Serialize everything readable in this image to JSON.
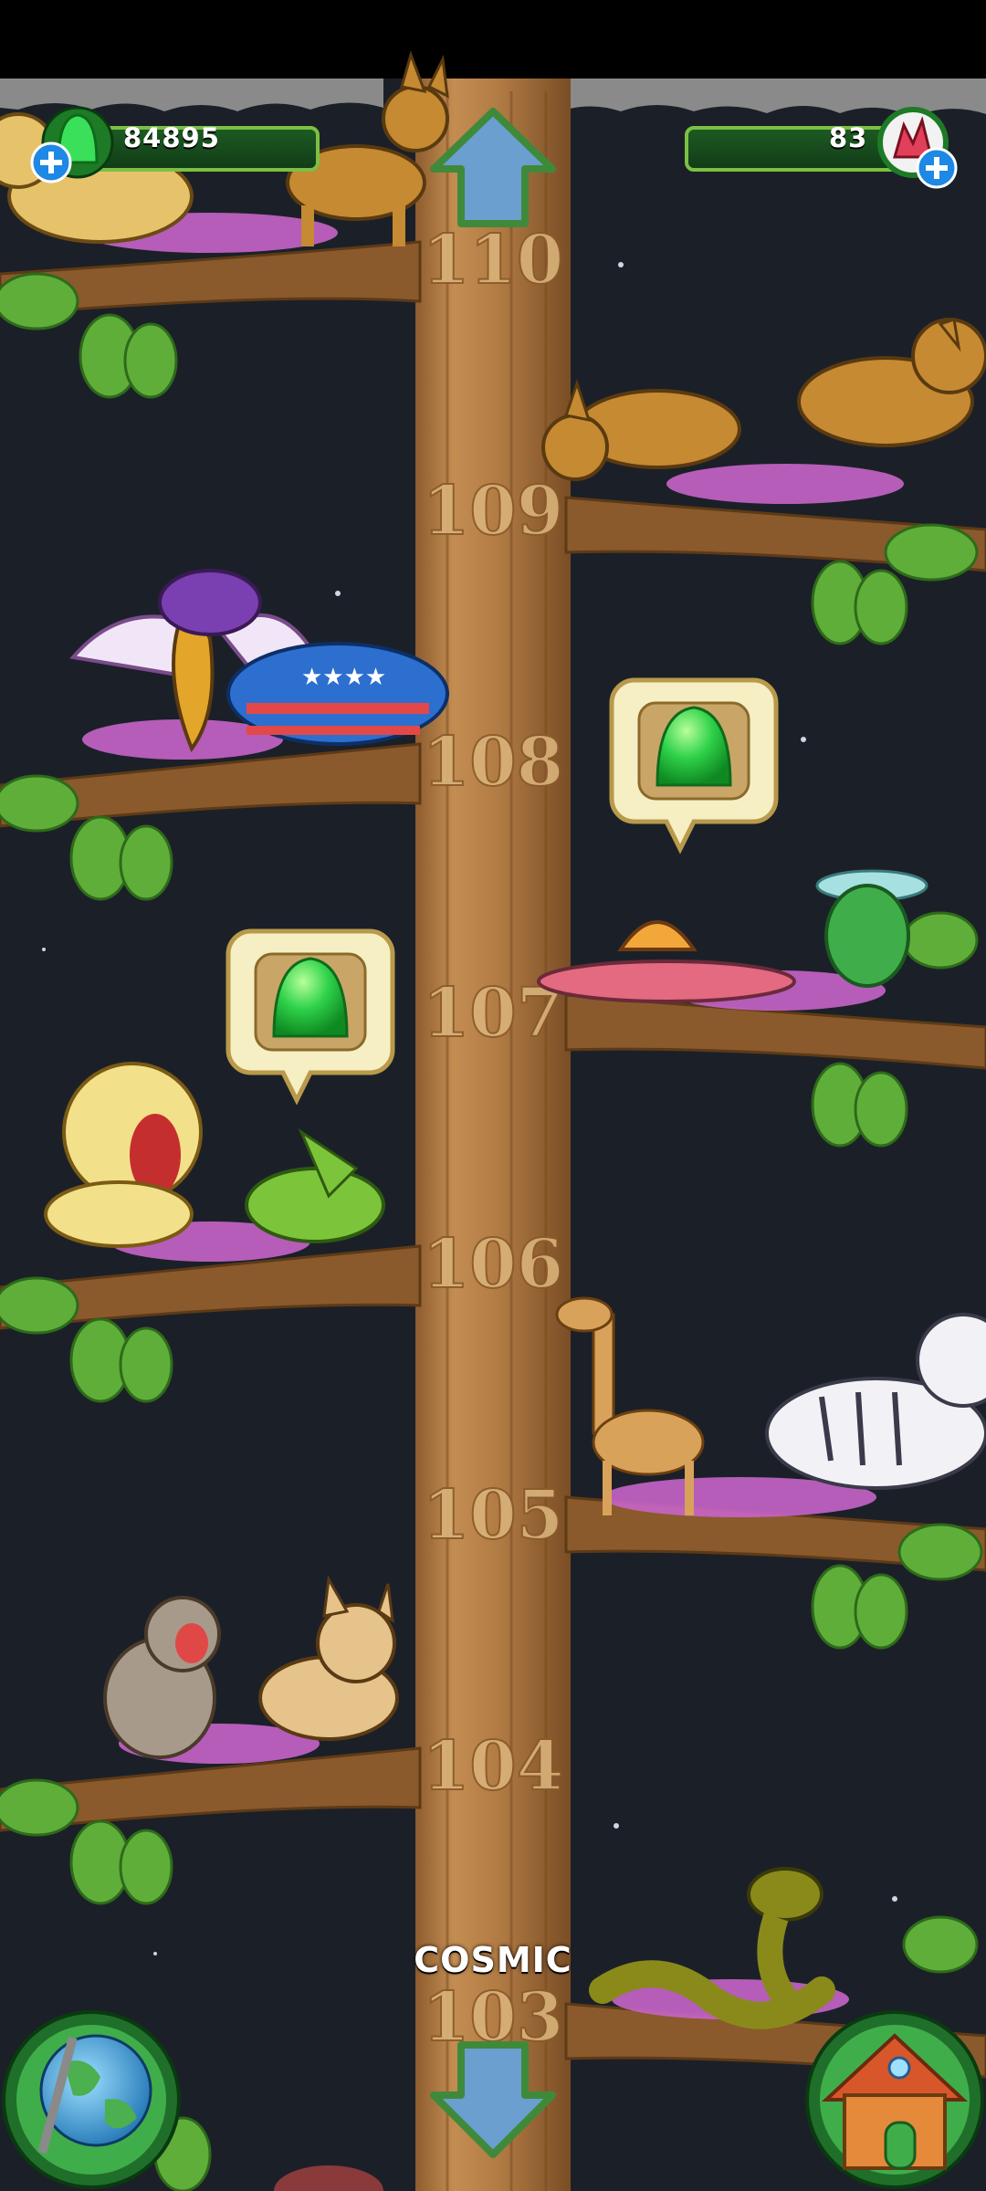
{
  "hud": {
    "gems_count": "84895",
    "crystals_count": "83"
  },
  "tree": {
    "levels": [
      "110",
      "109",
      "108",
      "107",
      "106",
      "105",
      "104",
      "103"
    ],
    "tier_label": "COSMIC"
  },
  "icons": {
    "gem": "green-gem-icon",
    "crystal": "red-crystal-icon",
    "plus": "plus-icon",
    "up": "arrow-up-icon",
    "down": "arrow-down-icon",
    "globe": "globe-icon",
    "house": "house-icon"
  },
  "colors": {
    "background": "#1b2028",
    "trunk": "#b8834a",
    "leaf": "#5fae3a",
    "hud_green": "#1c5a22",
    "gem_green": "#33d44a",
    "crystal_red": "#e0405a"
  }
}
